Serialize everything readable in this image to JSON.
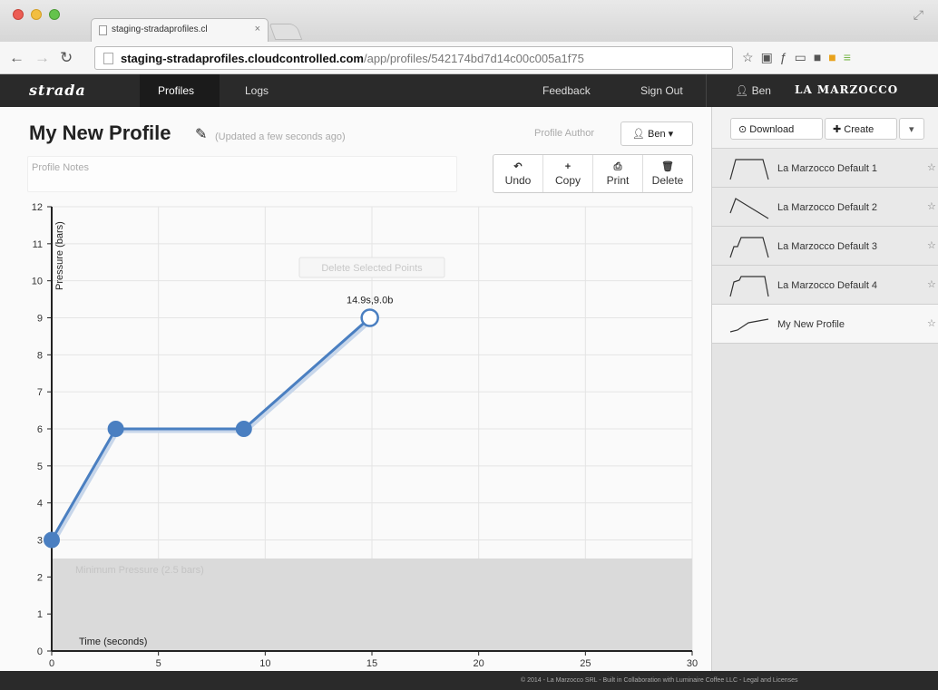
{
  "browser": {
    "tab_title": "staging-stradaprofiles.cl",
    "tab_close": "×",
    "url_domain": "staging-stradaprofiles.cloudcontrolled.com",
    "url_path": "/app/profiles/542174bd7d14c00c005a1f75"
  },
  "nav": {
    "brand": "strada",
    "profiles": "Profiles",
    "logs": "Logs",
    "feedback": "Feedback",
    "signout": "Sign Out",
    "user": "Ben",
    "lamarzocco": "LA MARZOCCO"
  },
  "profile": {
    "title": "My New Profile",
    "updated": "(Updated a few seconds ago)",
    "author_label": "Profile Author",
    "author": "Ben",
    "notes_placeholder": "Profile Notes"
  },
  "toolbar": {
    "undo": "Undo",
    "copy": "Copy",
    "print": "Print",
    "delete": "Delete"
  },
  "chart_data": {
    "type": "line",
    "xlabel": "Time (seconds)",
    "ylabel": "Pressure (bars)",
    "xlim": [
      0,
      30
    ],
    "ylim": [
      0,
      12
    ],
    "x_ticks": [
      0,
      5,
      10,
      15,
      20,
      25,
      30
    ],
    "y_ticks": [
      0,
      1,
      2,
      3,
      4,
      5,
      6,
      7,
      8,
      9,
      10,
      11,
      12
    ],
    "grid": true,
    "points": [
      {
        "x": 0,
        "y": 3
      },
      {
        "x": 3,
        "y": 6
      },
      {
        "x": 9,
        "y": 6
      },
      {
        "x": 14.9,
        "y": 9.0
      }
    ],
    "selected_label": "14.9s,9.0b",
    "min_pressure": 2.5,
    "min_pressure_label": "Minimum Pressure (2.5 bars)",
    "delete_selected_label": "Delete Selected Points",
    "line_color": "#4a7fc1",
    "min_band_color": "#dadada"
  },
  "sidebar": {
    "download": "Download",
    "create": "Create",
    "items": [
      {
        "name": "La Marzocco Default 1",
        "active": false
      },
      {
        "name": "La Marzocco Default 2",
        "active": false
      },
      {
        "name": "La Marzocco Default 3",
        "active": false
      },
      {
        "name": "La Marzocco Default 4",
        "active": false
      },
      {
        "name": "My New Profile",
        "active": true
      }
    ]
  },
  "footer": {
    "text": "© 2014 - La Marzocco SRL - Built in Collaboration with Luminaire Coffee LLC - Legal and Licenses"
  }
}
